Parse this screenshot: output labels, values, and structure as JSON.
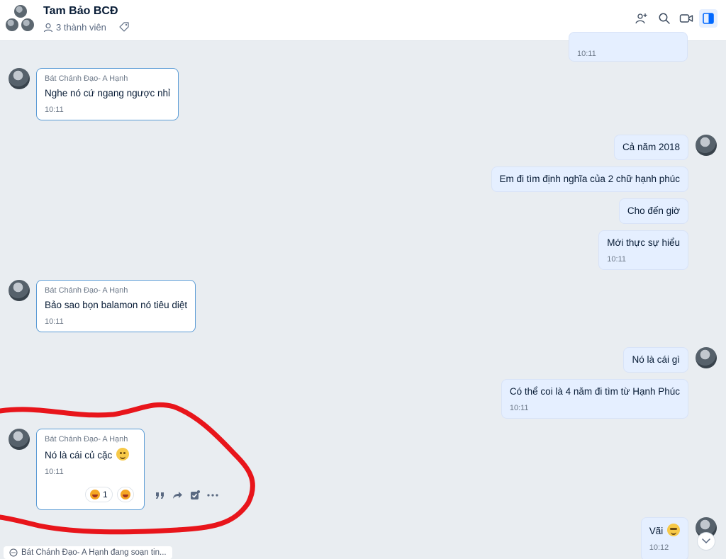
{
  "header": {
    "title": "Tam Bảo BCĐ",
    "members_label": "3 thành viên",
    "icons": [
      "add-member-icon",
      "search-icon",
      "video-call-icon",
      "sidebar-toggle-icon"
    ]
  },
  "messages": {
    "m0": {
      "time": "10:11"
    },
    "m1": {
      "sender": "Bát Chánh Đạo- A Hạnh",
      "text": "Nghe nó cứ ngang ngược nhỉ",
      "time": "10:11"
    },
    "m2": {
      "text": "Cả năm 2018"
    },
    "m3": {
      "text": "Em đi tìm định nghĩa của 2 chữ hạnh phúc"
    },
    "m4": {
      "text": "Cho đến giờ"
    },
    "m5": {
      "text": "Mới thực sự hiểu",
      "time": "10:11"
    },
    "m6": {
      "sender": "Bát Chánh Đạo- A Hạnh",
      "text": "Bảo sao bọn balamon nó tiêu diệt",
      "time": "10:11"
    },
    "m7": {
      "text": "Nó là cái gì"
    },
    "m8": {
      "text": "Có thể coi là 4 năm đi tìm từ Hạnh Phúc",
      "time": "10:11"
    },
    "m9": {
      "sender": "Bát Chánh Đạo- A Hạnh",
      "text": "Nó là cái củ cặc",
      "time": "10:11",
      "reaction_count": "1"
    },
    "m10": {
      "text": "Vãi",
      "time": "10:12"
    }
  },
  "typing_indicator": "Bát Chánh Đạo- A Hạnh đang soạn tin...",
  "colors": {
    "accent": "#0068ff",
    "incoming_border": "#5a9bd5",
    "outgoing_bg": "#e5efff",
    "annotation_red": "#e8151b"
  }
}
